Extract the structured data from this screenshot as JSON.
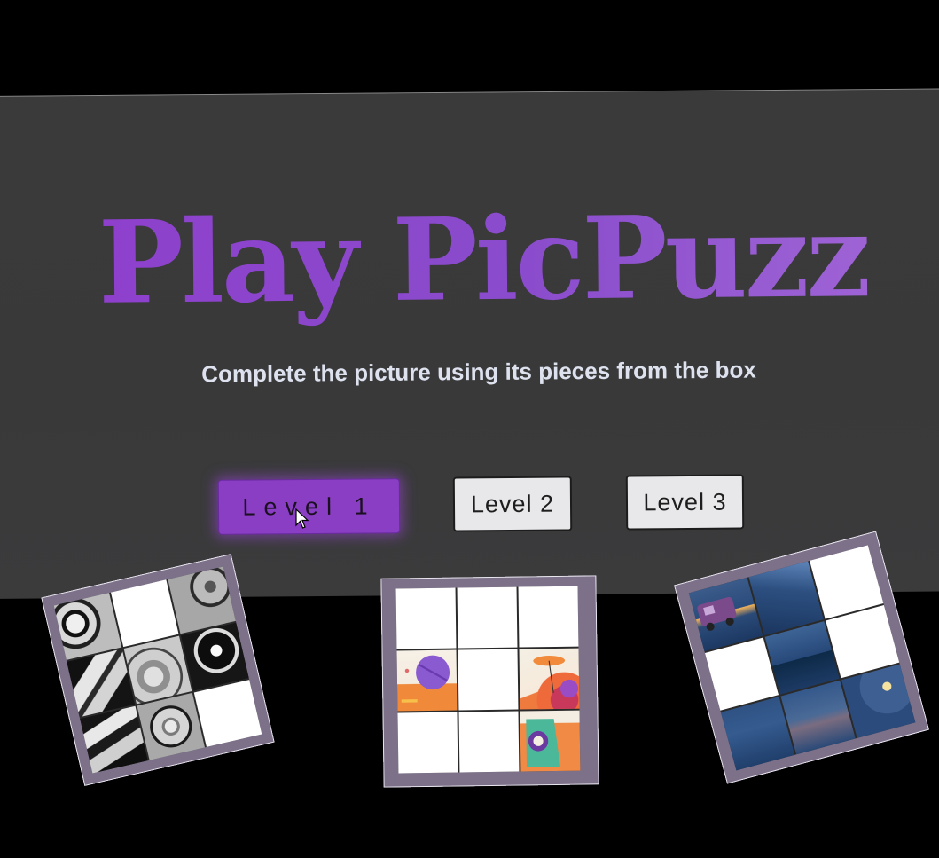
{
  "game": {
    "title": "Play PicPuzz",
    "subtitle": "Complete the picture using its pieces from the box"
  },
  "levels": [
    {
      "label": "Level 1",
      "selected": true
    },
    {
      "label": "Level 2",
      "selected": false
    },
    {
      "label": "Level 3",
      "selected": false
    }
  ],
  "colors": {
    "background": "#000000",
    "panel": "#3a3a3b",
    "accent": "#8a3ec4",
    "title": "#9a4fd0",
    "button": "#e8e8ea",
    "card_frame": "#7d7089"
  },
  "puzzles": [
    {
      "theme": "manga",
      "empty_tiles": 2,
      "filled_tiles": 7
    },
    {
      "theme": "space",
      "empty_tiles": 6,
      "filled_tiles": 3
    },
    {
      "theme": "night-mountains",
      "empty_tiles": 3,
      "filled_tiles": 6
    }
  ],
  "icons": {
    "cursor": "pointer-cursor-icon"
  }
}
